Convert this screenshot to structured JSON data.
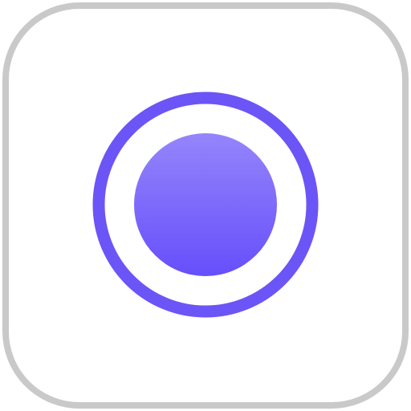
{
  "icon": {
    "name": "record-button-app-icon",
    "glyph": "record-icon"
  },
  "colors": {
    "background": "#ffffff",
    "tile_fill": "#ffffff",
    "tile_border": "#c9c9c9",
    "ring": "#6b55f6",
    "dot_top": "#9585fb",
    "dot_bottom": "#664ffb"
  }
}
